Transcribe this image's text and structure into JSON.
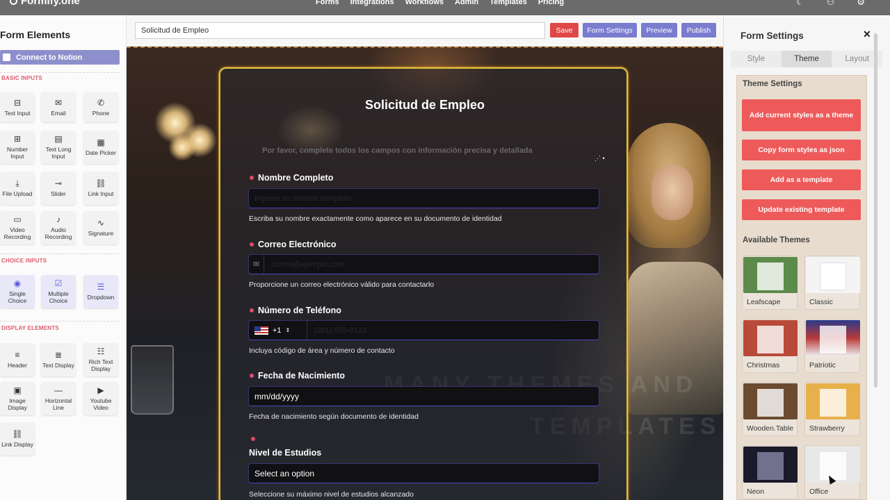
{
  "app": {
    "logo": "Formify.one"
  },
  "nav": {
    "items": [
      "Forms",
      "Integrations",
      "Workflows",
      "Admin",
      "Templates",
      "Pricing"
    ]
  },
  "top_icons": [
    "moon-icon",
    "user-icon",
    "settings-icon"
  ],
  "left": {
    "title": "Form Elements",
    "connect_button": "Connect to Notion",
    "sections": [
      {
        "title": "BASIC INPUTS",
        "items": [
          {
            "label": "Text Input",
            "icon": "text-input-icon"
          },
          {
            "label": "Email",
            "icon": "email-icon"
          },
          {
            "label": "Phone",
            "icon": "phone-icon"
          },
          {
            "label": "Number Input",
            "icon": "number-icon"
          },
          {
            "label": "Text Long Input",
            "icon": "text-long-icon"
          },
          {
            "label": "Date Picker",
            "icon": "calendar-icon"
          },
          {
            "label": "File Upload",
            "icon": "upload-icon"
          },
          {
            "label": "Slider",
            "icon": "slider-icon"
          },
          {
            "label": "Link Input",
            "icon": "link-icon"
          },
          {
            "label": "Video Recording",
            "icon": "video-icon"
          },
          {
            "label": "Audio Recording",
            "icon": "mic-icon"
          },
          {
            "label": "Signature",
            "icon": "signature-icon"
          }
        ]
      },
      {
        "title": "CHOICE INPUTS",
        "items": [
          {
            "label": "Single Choice",
            "icon": "radio-icon"
          },
          {
            "label": "Multiple Choice",
            "icon": "checkbox-icon"
          },
          {
            "label": "Dropdown",
            "icon": "dropdown-icon"
          }
        ]
      },
      {
        "title": "DISPLAY ELEMENTS",
        "items": [
          {
            "label": "Header",
            "icon": "header-icon"
          },
          {
            "label": "Text Display",
            "icon": "text-display-icon"
          },
          {
            "label": "Rich Text Display",
            "icon": "rich-text-icon"
          },
          {
            "label": "Image Display",
            "icon": "image-icon"
          },
          {
            "label": "Horizontal Line",
            "icon": "line-icon"
          },
          {
            "label": "Youtube Video",
            "icon": "youtube-icon"
          },
          {
            "label": "Link Display",
            "icon": "link-display-icon"
          }
        ]
      }
    ]
  },
  "toolbar": {
    "form_name": "Solicitud de Empleo",
    "save": "Save",
    "form_settings": "Form Settings",
    "preview": "Preview",
    "publish": "Publish",
    "colors": {
      "save": "#e04848",
      "other": "#7a7ccf"
    }
  },
  "form": {
    "title": "Solicitud de Empleo",
    "subtitle": "Por favor, complete todos los campos con información precisa y detallada",
    "fields": [
      {
        "label": "Nombre Completo",
        "placeholder": "Ingrese su nombre completo",
        "help": "Escriba su nombre exactamente como aparece en su documento de identidad"
      },
      {
        "label": "Correo Electrónico",
        "placeholder": "correo@ejemplo.com",
        "help": "Proporcione un correo electrónico válido para contactarlo"
      },
      {
        "label": "Número de Teléfono",
        "prefix": "+1",
        "placeholder": "(201) 555-0123",
        "help": "Incluya código de área y número de contacto"
      },
      {
        "label": "Fecha de Nacimiento",
        "value": "mm/dd/yyyy",
        "help": "Fecha de nacimiento según documento de identidad"
      },
      {
        "label": "Nivel de Estudios",
        "value": "Select an option",
        "help": "Seleccione su máximo nivel de estudios alcanzado"
      }
    ],
    "watermark": [
      "MANY THEMES AND",
      "TEMPLATES"
    ]
  },
  "right": {
    "title": "Form Settings",
    "tabs": [
      "Style",
      "Theme",
      "Layout"
    ],
    "active_tab": "Theme",
    "theme_settings": "Theme Settings",
    "buttons": [
      "Add current styles as a theme",
      "Copy form styles as json",
      "Add as a template",
      "Update existing template"
    ],
    "available_title": "Available Themes",
    "themes": [
      {
        "name": "Leafscape",
        "color": "#5c8a4a"
      },
      {
        "name": "Classic",
        "color": "#f4f4f4"
      },
      {
        "name": "Christmas",
        "color": "#b84a3a"
      },
      {
        "name": "Patriotic",
        "color": "#b83a3a"
      },
      {
        "name": "Wooden.Table",
        "color": "#6b4a30"
      },
      {
        "name": "Strawberry",
        "color": "#e8b04a"
      },
      {
        "name": "Neon",
        "color": "#1a1a2a"
      },
      {
        "name": "Office",
        "color": "#e8e8e8"
      }
    ]
  }
}
